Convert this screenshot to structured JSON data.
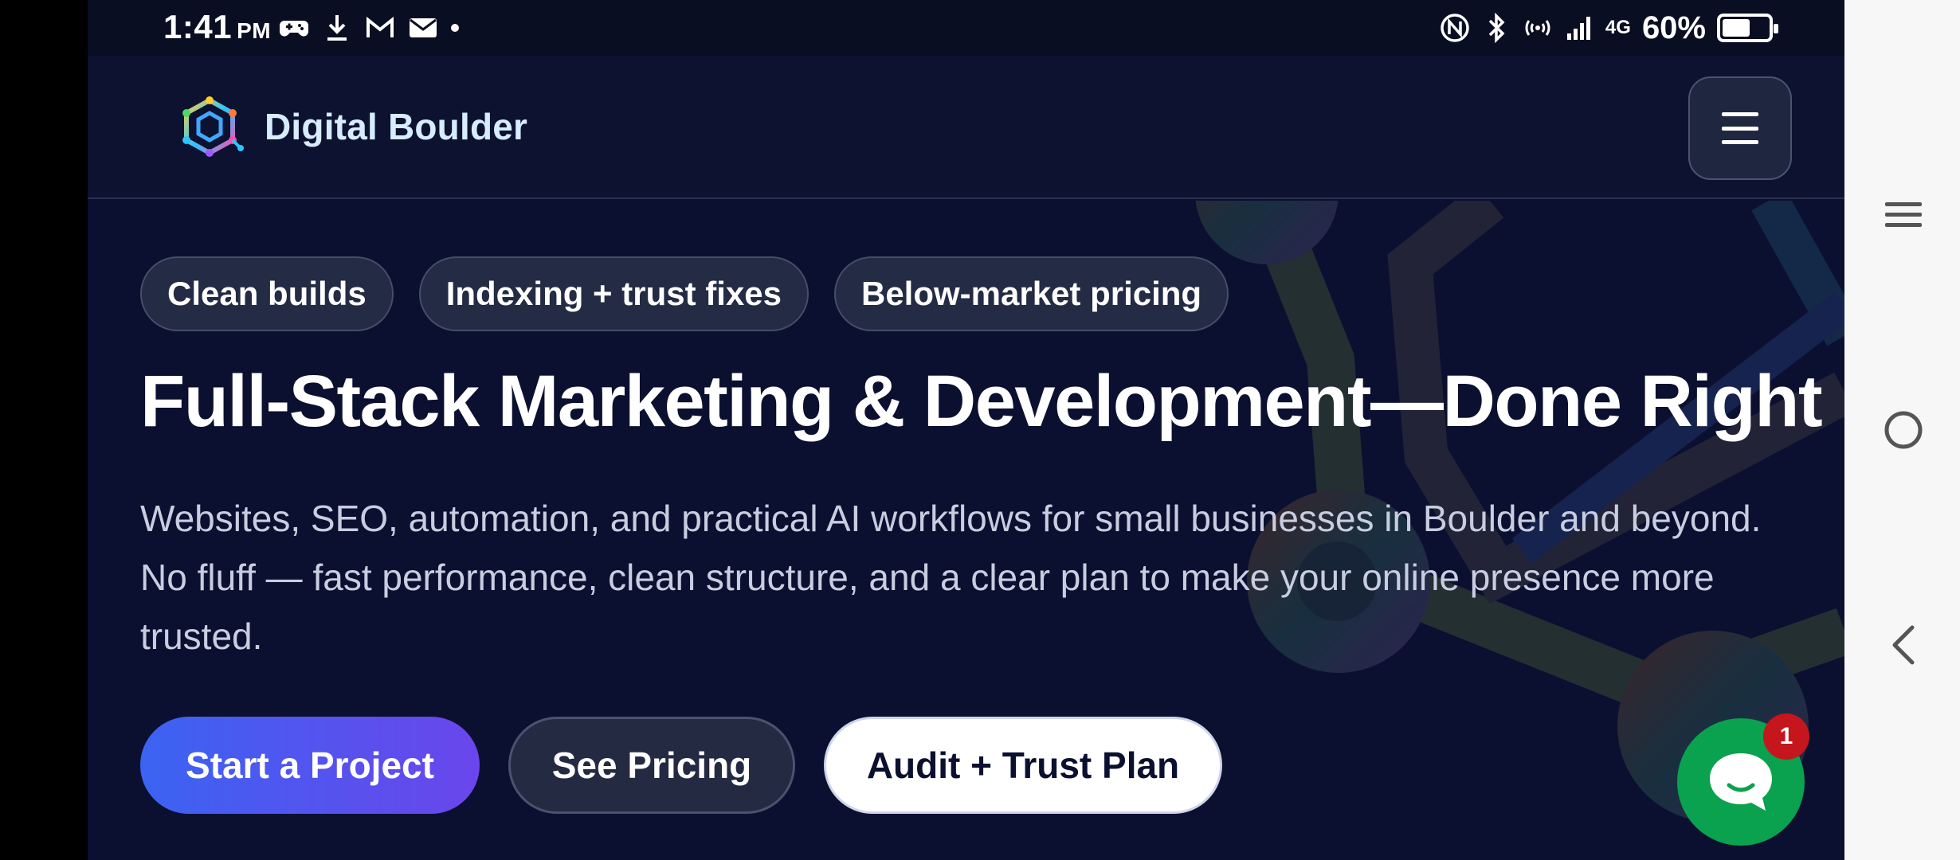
{
  "status_bar": {
    "time": "1:41",
    "ampm": "PM",
    "battery_text": "60%",
    "network": "4G",
    "battery_level": 0.6
  },
  "header": {
    "brand_name": "Digital Boulder"
  },
  "hero": {
    "chips": [
      "Clean builds",
      "Indexing + trust fixes",
      "Below-market pricing"
    ],
    "headline": "Full-Stack Marketing & Development—Done Right",
    "subtext": "Websites, SEO, automation, and practical AI workflows for small businesses in Boulder and beyond. No fluff — fast performance, clean structure, and a clear plan to make your online presence more trusted.",
    "cta_primary": "Start a Project",
    "cta_secondary": "See Pricing",
    "cta_outline": "Audit + Trust Plan"
  },
  "chat": {
    "badge_count": "1"
  },
  "colors": {
    "background": "#0b1030",
    "primary_gradient_start": "#3b63f2",
    "primary_gradient_end": "#6a46ec",
    "chat_green": "#0aa14f",
    "badge_red": "#c4161c"
  }
}
